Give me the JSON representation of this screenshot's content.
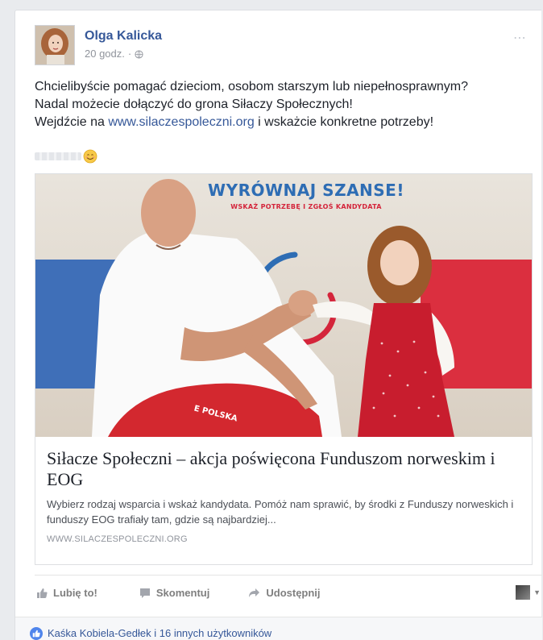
{
  "post": {
    "author": "Olga Kalicka",
    "time": "20 godz.",
    "separator": "·",
    "text_line1": "Chcielibyście pomagać dzieciom, osobom starszym lub niepełnosprawnym?",
    "text_line2": "Nadal możecie dołączyć do grona Siłaczy Społecznych!",
    "text_line3_before": "Wejdźcie na ",
    "text_link": "www.silaczespoleczni.org",
    "text_line3_after": " i wskażcie konkretne potrzeby!",
    "emoji_icon": "smiley-face-icon"
  },
  "link_preview": {
    "image_heading": "WYRÓWNAJ SZANSE!",
    "image_subheading": "WSKAŻ POTRZEBĘ I ZGŁOŚ KANDYDATA",
    "shirt_text": "E POLSKA",
    "title": "Siłacze Społeczni – akcja poświęcona Funduszom norweskim i EOG",
    "description": "Wybierz rodzaj wsparcia i wskaż kandydata. Pomóż nam sprawić, by środki z Funduszy norweskich i funduszy EOG trafiały tam, gdzie są najbardziej...",
    "domain": "WWW.SILACZESPOLECZNI.ORG"
  },
  "actions": {
    "like_label": "Lubię to!",
    "comment_label": "Skomentuj",
    "share_label": "Udostępnij",
    "caret": "▼"
  },
  "reactions": {
    "text": "Kaśka Kobiela-Gedłek i 16 innych użytkowników"
  },
  "colors": {
    "link_blue": "#365899",
    "banner_blue": "#2e6db4",
    "banner_red": "#d4253b",
    "like_blue": "#4f85ec"
  }
}
